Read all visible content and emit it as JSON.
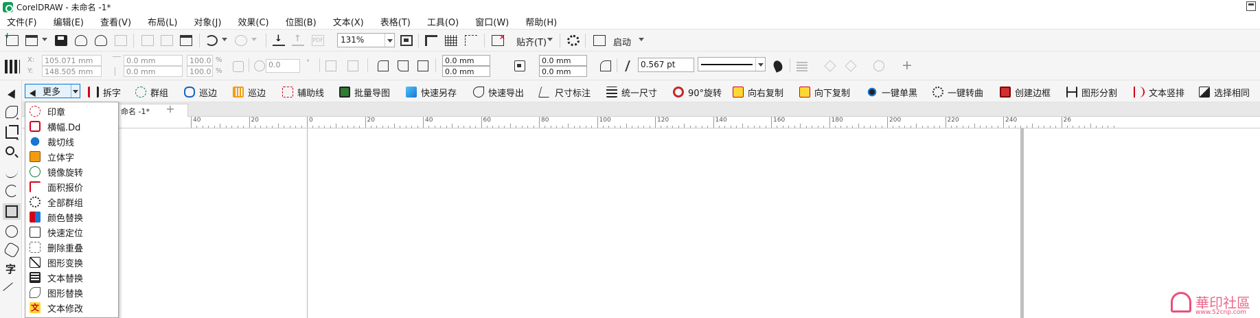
{
  "window": {
    "title": "CorelDRAW - 未命名 -1*"
  },
  "menubar": {
    "items": [
      "文件(F)",
      "编辑(E)",
      "查看(V)",
      "布局(L)",
      "对象(J)",
      "效果(C)",
      "位图(B)",
      "文本(X)",
      "表格(T)",
      "工具(O)",
      "窗口(W)",
      "帮助(H)"
    ]
  },
  "toolbar": {
    "zoom": "131%",
    "snap_label": "贴齐(T)",
    "launch_label": "启动",
    "pdf_label": "PDF"
  },
  "property_bar": {
    "x_label": "X:",
    "y_label": "Y:",
    "x": "105.071 mm",
    "y": "148.505 mm",
    "width": "0.0 mm",
    "height": "0.0 mm",
    "scale_w": "100.0",
    "scale_h": "100.0",
    "percent": "%",
    "rotation": "0.0",
    "degree": "°",
    "corner_1": "0.0 mm",
    "corner_2": "0.0 mm",
    "corner_3": "0.0 mm",
    "corner_4": "0.0 mm",
    "outline_width": "0.567 pt"
  },
  "plugins": {
    "more_label": "更多",
    "items": [
      "拆字",
      "群组",
      "巡边",
      "巡边",
      "辅助线",
      "批量导图",
      "快速另存",
      "快速导出",
      "尺寸标注",
      "统一尺寸",
      "90°旋转",
      "向右复制",
      "向下复制",
      "一键单黑",
      "一键转曲",
      "创建边框",
      "图形分割",
      "文本竖排",
      "选择相同"
    ]
  },
  "more_menu": {
    "items": [
      "印章",
      "横幅.Dd",
      "裁切线",
      "立体字",
      "镜像旋转",
      "面积报价",
      "全部群组",
      "颜色替换",
      "快速定位",
      "删除重叠",
      "图形变换",
      "文本替换",
      "图形替换",
      "文本修改"
    ]
  },
  "document": {
    "tab_label": "命名 -1*",
    "add_tab": "+"
  },
  "ruler": {
    "labels": [
      "40",
      "20",
      "0",
      "20",
      "40",
      "60",
      "80",
      "100",
      "120",
      "140",
      "160",
      "180",
      "200",
      "220",
      "240",
      "26"
    ]
  },
  "toolbox": {
    "text_tool_glyph": "字"
  },
  "watermark": {
    "text": "華印社區",
    "url": "www.52cnp.com"
  },
  "colors": {
    "accent": "#0078d7",
    "more_button_bg": "#e5f1fb",
    "watermark": "#e7507a",
    "bar_bg": "#f5f5f5"
  }
}
